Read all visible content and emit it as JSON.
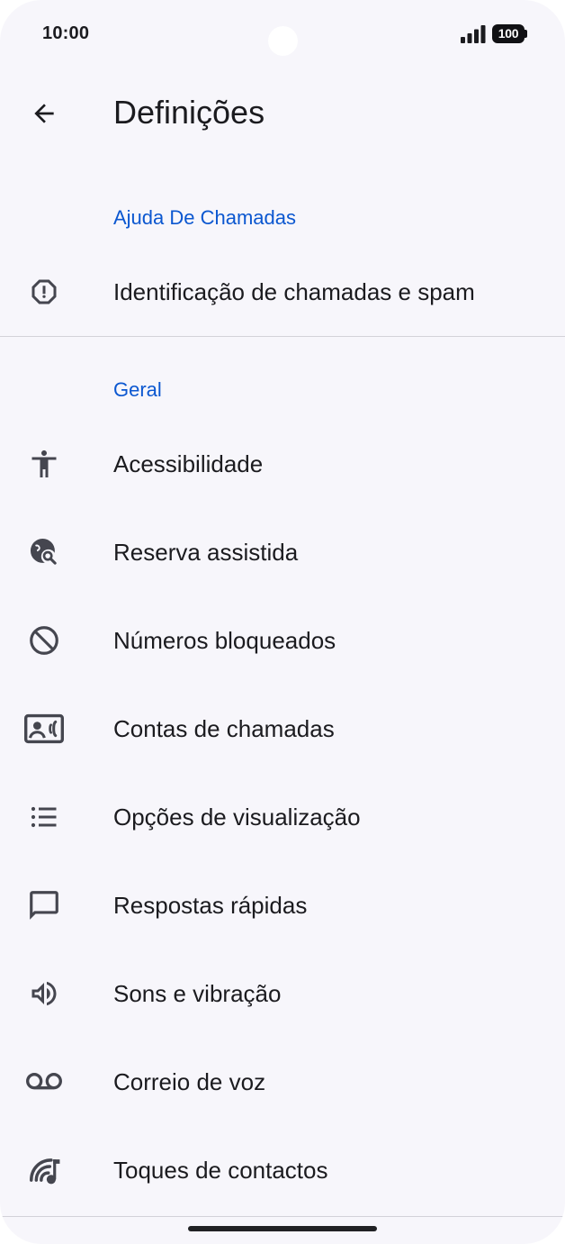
{
  "status_bar": {
    "time": "10:00",
    "battery": "100"
  },
  "app_bar": {
    "title": "Definições"
  },
  "sections": {
    "call_help": {
      "header": "Ajuda De Chamadas",
      "items": [
        {
          "label": "Identificação de chamadas e spam",
          "icon": "spam-alert-icon"
        }
      ]
    },
    "general": {
      "header": "Geral",
      "items": [
        {
          "label": "Acessibilidade",
          "icon": "accessibility-icon"
        },
        {
          "label": "Reserva assistida",
          "icon": "travel-explore-icon"
        },
        {
          "label": "Números bloqueados",
          "icon": "block-icon"
        },
        {
          "label": "Contas de chamadas",
          "icon": "contact-phone-icon"
        },
        {
          "label": "Opções de visualização",
          "icon": "list-icon"
        },
        {
          "label": "Respostas rápidas",
          "icon": "chat-bubble-icon"
        },
        {
          "label": "Sons e vibração",
          "icon": "volume-icon"
        },
        {
          "label": "Correio de voz",
          "icon": "voicemail-icon"
        },
        {
          "label": "Toques de contactos",
          "icon": "ringtone-icon"
        }
      ]
    }
  },
  "colors": {
    "accent": "#0b57d0",
    "background": "#f7f6fb",
    "text": "#1b1b1f",
    "icon": "#45464f"
  }
}
